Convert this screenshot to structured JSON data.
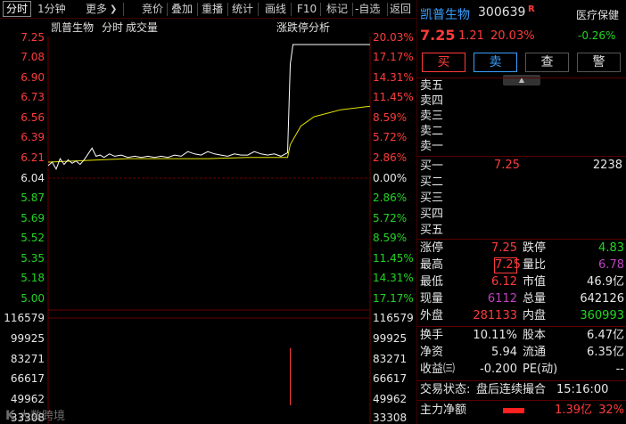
{
  "toolbar": {
    "items": [
      "分时",
      "1分钟",
      "更多",
      "竞价",
      "叠加",
      "重播",
      "统计",
      "画线",
      "F10",
      "标记",
      "-自选",
      "返回"
    ],
    "more_arrow": "❯"
  },
  "chart": {
    "stock_name": "凯普生物",
    "mode": "分时",
    "volume_label": "成交量",
    "analysis_label": "涨跌停分析",
    "price_ticks": [
      "7.25",
      "7.08",
      "6.90",
      "6.73",
      "6.56",
      "6.39",
      "6.21",
      "6.04",
      "5.87",
      "5.69",
      "5.52",
      "5.35",
      "5.18",
      "5.00"
    ],
    "pct_ticks": [
      "20.03%",
      "17.17%",
      "14.31%",
      "11.45%",
      "8.59%",
      "5.72%",
      "2.86%",
      "0.00%",
      "2.86%",
      "5.72%",
      "8.59%",
      "11.45%",
      "14.31%",
      "17.17%"
    ],
    "vol_ticks": [
      "116579",
      "99925",
      "83271",
      "66617",
      "49962",
      "33308"
    ],
    "watermark": "大数跨境",
    "watermark_mark": "K"
  },
  "colors": {
    "up": "#ff3b3b",
    "down": "#22d622",
    "price_line": "#ffffff",
    "avg_line": "#e6e600",
    "accent": "#3aa0ff",
    "purple": "#c040c0"
  },
  "header": {
    "name": "凯普生物",
    "code": "300639",
    "badge": "R",
    "sector": "医疗保健",
    "sector_change": "-0.26%",
    "price": "7.25",
    "change": "1.21",
    "change_pct": "20.03%"
  },
  "buttons": {
    "buy": "买",
    "sell": "卖",
    "query": "查",
    "alert": "警"
  },
  "orderbook": {
    "sells": [
      "卖五",
      "卖四",
      "卖三",
      "卖二",
      "卖一"
    ],
    "buys": [
      {
        "label": "买一",
        "price": "7.25",
        "vol": "2238"
      },
      {
        "label": "买二",
        "price": "",
        "vol": ""
      },
      {
        "label": "买三",
        "price": "",
        "vol": ""
      },
      {
        "label": "买四",
        "price": "",
        "vol": ""
      },
      {
        "label": "买五",
        "price": "",
        "vol": ""
      }
    ]
  },
  "stats": {
    "zt_label": "涨停",
    "zt": "7.25",
    "dt_label": "跌停",
    "dt": "4.83",
    "high_label": "最高",
    "high": "7.25",
    "lb_label": "量比",
    "lb": "6.78",
    "low_label": "最低",
    "low": "6.12",
    "sz_label": "市值",
    "sz": "46.9亿",
    "xl_label": "现量",
    "xl": "6112",
    "zl_label": "总量",
    "zl": "642126",
    "wp_label": "外盘",
    "wp": "281133",
    "np_label": "内盘",
    "np": "360993",
    "hs_label": "换手",
    "hs": "10.11%",
    "gb_label": "股本",
    "gb": "6.47亿",
    "jz_label": "净资",
    "jz": "5.94",
    "lt_label": "流通",
    "lt": "6.35亿",
    "sy_label": "收益㈢",
    "sy": "-0.200",
    "pe_label": "PE(动)",
    "pe": "--"
  },
  "status": {
    "label": "交易状态:",
    "value": "盘后连续撮合",
    "time": "15:16:00"
  },
  "netflow": {
    "label": "主力净额",
    "value": "1.39亿",
    "pct": "32%"
  },
  "chart_data": {
    "type": "line",
    "prev_close": 6.04,
    "ylim": [
      5.0,
      7.25
    ],
    "vol_ylim": [
      33308,
      116579
    ],
    "price_series": [
      [
        0,
        6.21
      ],
      [
        3,
        6.24
      ],
      [
        6,
        6.18
      ],
      [
        9,
        6.27
      ],
      [
        12,
        6.22
      ],
      [
        15,
        6.26
      ],
      [
        18,
        6.23
      ],
      [
        21,
        6.25
      ],
      [
        24,
        6.22
      ],
      [
        27,
        6.26
      ],
      [
        30,
        6.31
      ],
      [
        33,
        6.36
      ],
      [
        36,
        6.29
      ],
      [
        39,
        6.3
      ],
      [
        42,
        6.28
      ],
      [
        46,
        6.31
      ],
      [
        50,
        6.29
      ],
      [
        55,
        6.3
      ],
      [
        60,
        6.28
      ],
      [
        65,
        6.29
      ],
      [
        70,
        6.28
      ],
      [
        75,
        6.29
      ],
      [
        80,
        6.28
      ],
      [
        85,
        6.29
      ],
      [
        90,
        6.28
      ],
      [
        95,
        6.3
      ],
      [
        100,
        6.29
      ],
      [
        105,
        6.33
      ],
      [
        110,
        6.31
      ],
      [
        115,
        6.3
      ],
      [
        120,
        6.33
      ],
      [
        125,
        6.31
      ],
      [
        130,
        6.3
      ],
      [
        135,
        6.29
      ],
      [
        140,
        6.31
      ],
      [
        145,
        6.3
      ],
      [
        150,
        6.3
      ],
      [
        155,
        6.33
      ],
      [
        160,
        6.31
      ],
      [
        165,
        6.3
      ],
      [
        170,
        6.31
      ],
      [
        175,
        6.29
      ],
      [
        180,
        6.32
      ],
      [
        182,
        7.08
      ],
      [
        184,
        7.25
      ],
      [
        242,
        7.25
      ]
    ],
    "avg_series": [
      [
        0,
        6.24
      ],
      [
        20,
        6.25
      ],
      [
        40,
        6.26
      ],
      [
        60,
        6.27
      ],
      [
        90,
        6.27
      ],
      [
        120,
        6.27
      ],
      [
        150,
        6.28
      ],
      [
        180,
        6.28
      ],
      [
        182,
        6.39
      ],
      [
        190,
        6.55
      ],
      [
        200,
        6.63
      ],
      [
        220,
        6.69
      ],
      [
        242,
        6.72
      ]
    ],
    "volume_spike": {
      "x": 182,
      "value": 95000
    }
  }
}
